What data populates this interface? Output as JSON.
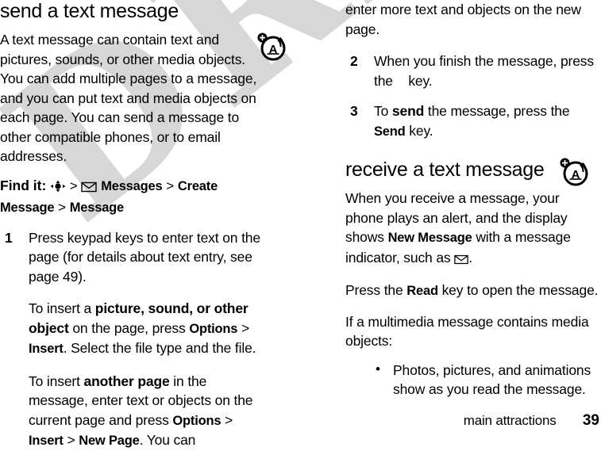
{
  "watermark": {
    "text": "DRAFT",
    "color": "#d7d7d7"
  },
  "footer": {
    "chapter": "main attractions",
    "page_number": "39"
  },
  "left_column": {
    "heading": "send a text message",
    "intro": "A text message can contain text and pictures, sounds, or other media objects. You can add multiple pages to a message, and you can put text and media objects on each page. You can send a message to other compatible phones, or to email addresses.",
    "find_it": {
      "label": "Find it:",
      "joystick_icon": "joystick-icon",
      "separator": ">",
      "messages_icon": "envelope-icon",
      "path": [
        "Messages",
        "Create Message",
        "Message"
      ]
    },
    "step1": {
      "number": "1",
      "text": "Press keypad keys to enter text on the page (for details about text entry, see page 49)."
    },
    "sub1": {
      "prefix": "To insert a ",
      "bold1": "picture, sound, or other object",
      "mid1": " on the page, press ",
      "ui1": "Options",
      "gt1": " > ",
      "ui2": "Insert",
      "tail": ". Select the file type and the file."
    },
    "sub2": {
      "prefix": "To insert ",
      "bold1": "another page",
      "mid1": " in the message, enter text or objects on the current page and press ",
      "ui1": "Options",
      "gt1": " > ",
      "ui2": "Insert",
      "gt2": " > ",
      "ui3": "New Page",
      "tail": ". You can"
    }
  },
  "right_column": {
    "continuation": "enter more text and objects on the new page.",
    "step2": {
      "number": "2",
      "text": "When you finish the message, press the",
      "text_line2": "key."
    },
    "step3": {
      "number": "3",
      "prefix": "To ",
      "bold1": "send",
      "mid1": " the message, press the ",
      "ui1": "Send",
      "tail": " key."
    },
    "heading": "receive a text message",
    "para1": {
      "prefix": "When you receive a message, your phone plays an alert, and the display shows ",
      "ui1": "New Message",
      "mid1": " with a message indicator, such as ",
      "envelope_icon": "envelope-icon",
      "tail": "."
    },
    "para2": {
      "prefix": "Press the ",
      "ui1": "Read",
      "tail": " key to open the message."
    },
    "para3": "If a multimedia message contains media objects:",
    "bullets": [
      {
        "marker": "•",
        "text": "Photos, pictures, and animations show as you read the message."
      }
    ]
  },
  "margin_icons": [
    {
      "name": "multimedia-message-icon",
      "glyph": "A"
    },
    {
      "name": "multimedia-message-icon",
      "glyph": "A"
    }
  ]
}
